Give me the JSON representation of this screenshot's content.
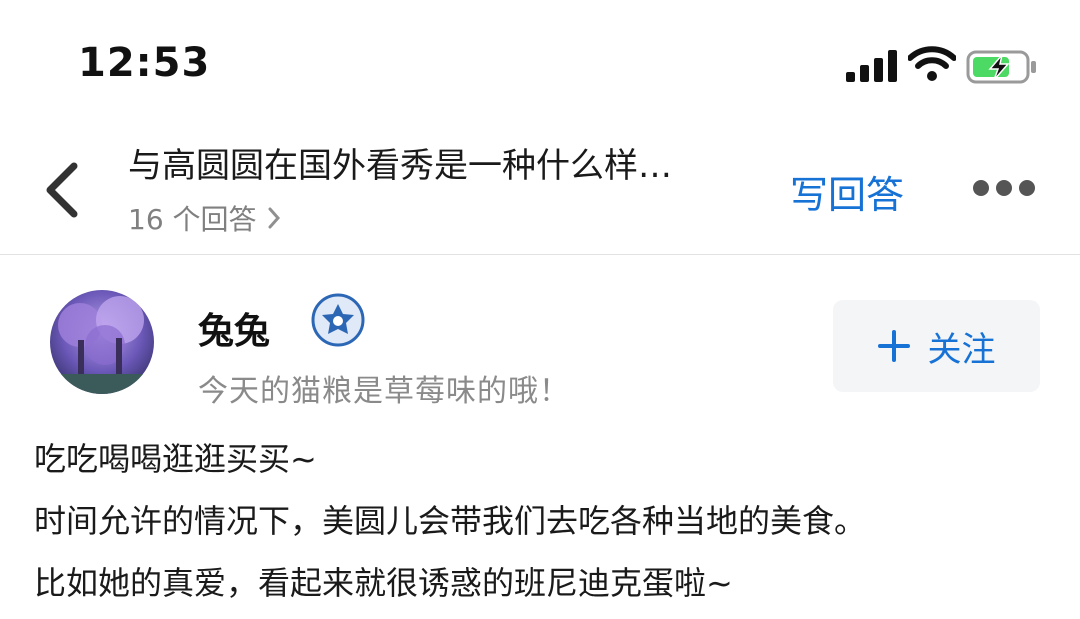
{
  "status_bar": {
    "time": "12:53"
  },
  "nav": {
    "question_title": "与高圆圆在国外看秀是一种什么样…",
    "answers_count": "16 个回答",
    "write_answer": "写回答"
  },
  "author": {
    "name": "兔兔",
    "bio": "今天的猫粮是草莓味的哦！",
    "follow_label": "关注"
  },
  "content": {
    "paragraphs": [
      "吃吃喝喝逛逛买买~",
      "时间允许的情况下，美圆儿会带我们去吃各种当地的美食。",
      "比如她的真爱，看起来就很诱惑的班尼迪克蛋啦~"
    ]
  },
  "colors": {
    "accent": "#1772d6",
    "muted": "#8a8a8a",
    "follow_bg": "#f4f5f7",
    "battery_green": "#4cd964"
  },
  "icons": [
    "signal-icon",
    "wifi-icon",
    "battery-charging-icon",
    "back-arrow-icon",
    "chevron-right-icon",
    "more-icon",
    "verified-badge-icon",
    "plus-icon"
  ]
}
